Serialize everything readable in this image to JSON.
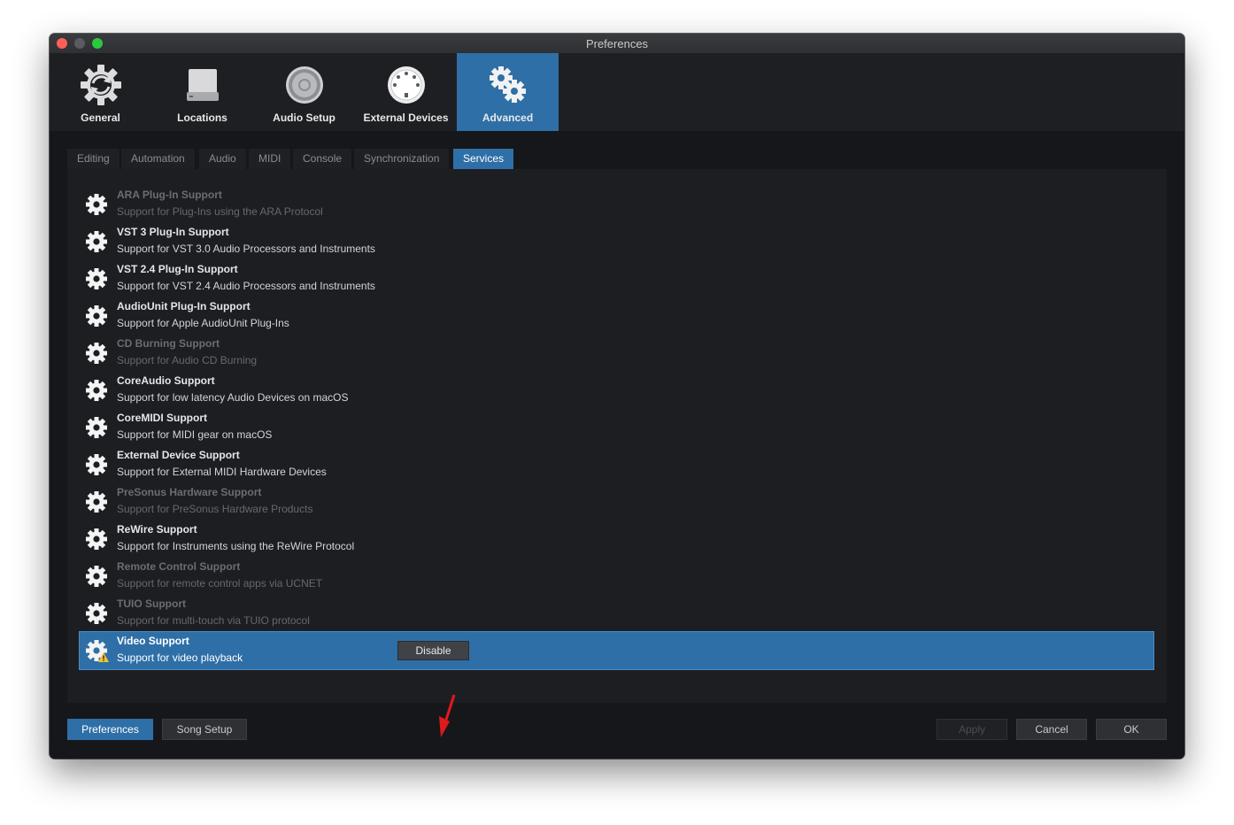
{
  "window": {
    "title": "Preferences"
  },
  "toolbar": {
    "items": [
      {
        "label": "General",
        "icon": "general-gear-icon"
      },
      {
        "label": "Locations",
        "icon": "drive-icon"
      },
      {
        "label": "Audio Setup",
        "icon": "speaker-icon"
      },
      {
        "label": "External Devices",
        "icon": "midi-connector-icon"
      },
      {
        "label": "Advanced",
        "icon": "gears-icon",
        "active": true
      }
    ]
  },
  "subtabs": [
    {
      "label": "Editing"
    },
    {
      "label": "Automation"
    },
    {
      "label": "Audio"
    },
    {
      "label": "MIDI"
    },
    {
      "label": "Console"
    },
    {
      "label": "Synchronization"
    },
    {
      "label": "Services",
      "active": true
    }
  ],
  "services": [
    {
      "name": "ARA Plug-In Support",
      "desc": "Support for Plug-Ins using the ARA Protocol",
      "enabled": false
    },
    {
      "name": "VST 3 Plug-In Support",
      "desc": "Support for VST 3.0 Audio Processors and Instruments",
      "enabled": true
    },
    {
      "name": "VST 2.4 Plug-In Support",
      "desc": "Support for VST 2.4 Audio Processors and Instruments",
      "enabled": true
    },
    {
      "name": "AudioUnit Plug-In Support",
      "desc": "Support for Apple AudioUnit Plug-Ins",
      "enabled": true
    },
    {
      "name": "CD Burning Support",
      "desc": "Support for Audio CD Burning",
      "enabled": false
    },
    {
      "name": "CoreAudio Support",
      "desc": "Support for low latency Audio Devices on macOS",
      "enabled": true
    },
    {
      "name": "CoreMIDI Support",
      "desc": "Support for MIDI gear on macOS",
      "enabled": true
    },
    {
      "name": "External Device Support",
      "desc": "Support for External MIDI Hardware Devices",
      "enabled": true
    },
    {
      "name": "PreSonus Hardware Support",
      "desc": "Support for PreSonus Hardware Products",
      "enabled": false
    },
    {
      "name": "ReWire Support",
      "desc": "Support for Instruments using the ReWire Protocol",
      "enabled": true
    },
    {
      "name": "Remote Control Support",
      "desc": "Support for remote control apps via UCNET",
      "enabled": false
    },
    {
      "name": "TUIO Support",
      "desc": "Support for multi-touch via TUIO protocol",
      "enabled": false
    },
    {
      "name": "Video Support",
      "desc": "Support for video playback",
      "enabled": true,
      "selected": true,
      "warning": true
    }
  ],
  "row_action": {
    "label": "Disable"
  },
  "bottom": {
    "preferences_label": "Preferences",
    "song_setup_label": "Song Setup",
    "apply_label": "Apply",
    "cancel_label": "Cancel",
    "ok_label": "OK"
  },
  "colors": {
    "accent": "#2f6fa7",
    "annotation_arrow": "#e0191c"
  }
}
